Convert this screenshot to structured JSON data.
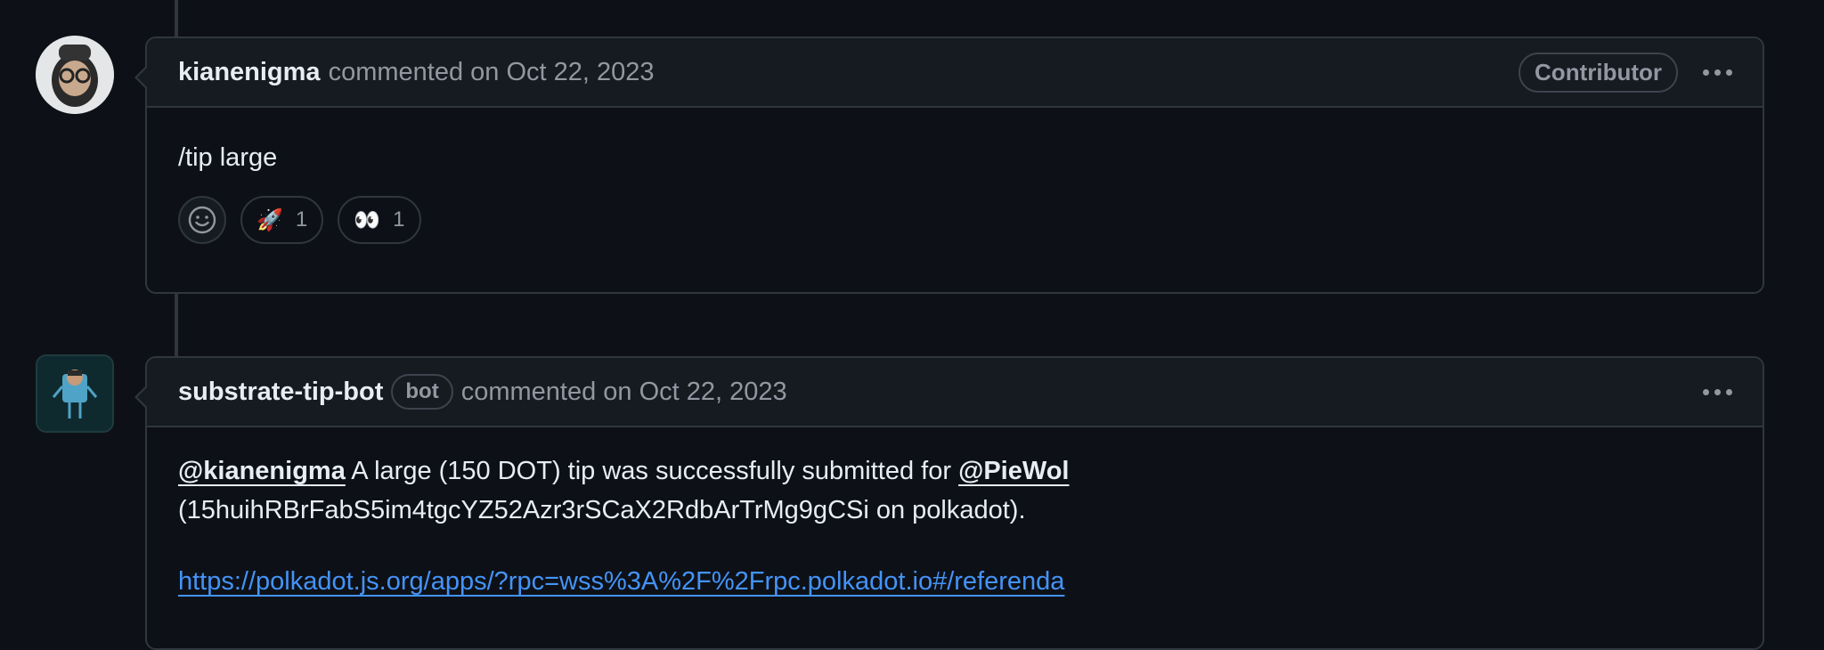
{
  "comments": [
    {
      "author": "kianenigma",
      "meta": "commented on Oct 22, 2023",
      "badge": "Contributor",
      "body": "/tip large",
      "reactions": [
        {
          "icon": "rocket-icon",
          "glyph": "🚀",
          "count": "1"
        },
        {
          "icon": "eyes-icon",
          "glyph": "👀",
          "count": "1"
        }
      ]
    },
    {
      "author": "substrate-tip-bot",
      "bot_label": "bot",
      "meta": "commented on Oct 22, 2023",
      "body": {
        "mention_author": "@kianenigma",
        "text_1": " A large (150 DOT) tip was successfully submitted for ",
        "mention_recipient": "@PieWol",
        "line_2": "(15huihRBrFabS5im4tgcYZ52Azr3rSCaX2RdbArTrMg9gCSi on polkadot).",
        "link": "https://polkadot.js.org/apps/?rpc=wss%3A%2F%2Frpc.polkadot.io#/referenda"
      }
    }
  ],
  "colors": {
    "background": "#0d1117",
    "header": "#161b22",
    "border": "#30363d",
    "link": "#4493f8",
    "muted": "#9198a1"
  }
}
